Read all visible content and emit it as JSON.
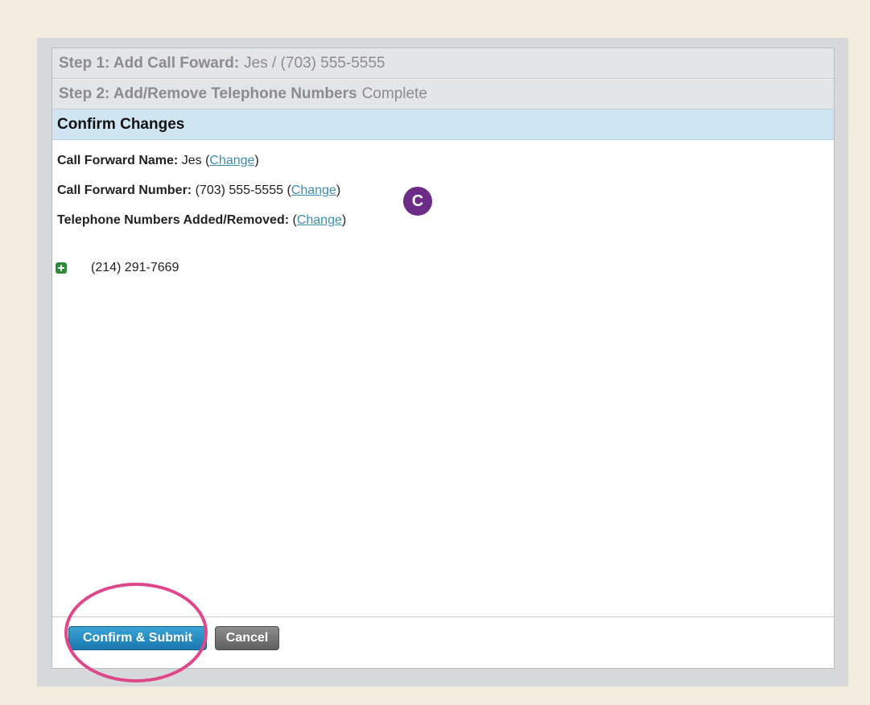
{
  "steps": {
    "step1": {
      "label": "Step 1: Add Call Foward:",
      "value": "Jes / (703) 555-5555"
    },
    "step2": {
      "label": "Step 2: Add/Remove Telephone Numbers",
      "value": "Complete"
    }
  },
  "confirm": {
    "heading": "Confirm Changes",
    "name_label": "Call Forward Name:",
    "name_value": " Jes ",
    "number_label": "Call Forward Number:",
    "number_value": " (703) 555-5555 ",
    "numbers_label": "Telephone Numbers Added/Removed:",
    "change_link": "Change",
    "open_paren": "(",
    "close_paren": ")",
    "added_numbers": [
      "(214) 291-7669"
    ]
  },
  "annotation": {
    "marker": "C"
  },
  "buttons": {
    "confirm_submit": "Confirm & Submit",
    "cancel": "Cancel"
  },
  "colors": {
    "accent_blue": "#1a78ad",
    "header_blue": "#cfe6f2",
    "marker_purple": "#6b2b86",
    "highlight_pink": "#e0468a",
    "add_green": "#2e8b3a"
  },
  "icons": {
    "added": "plus-icon"
  }
}
